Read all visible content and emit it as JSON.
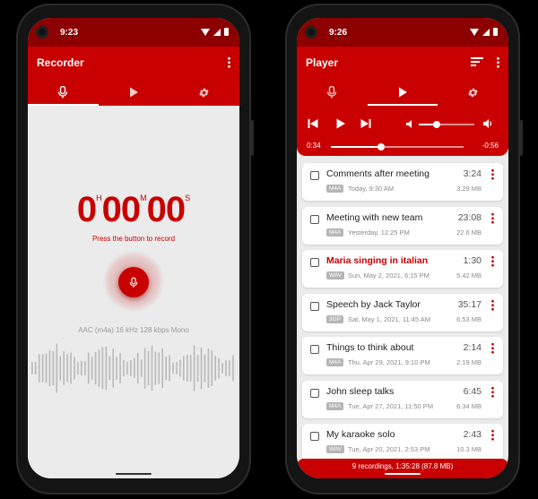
{
  "recorder": {
    "status_time": "9:23",
    "title": "Recorder",
    "tabs": [
      {
        "icon": "mic-icon",
        "active": true
      },
      {
        "icon": "play-icon",
        "active": false
      },
      {
        "icon": "gear-icon",
        "active": false
      }
    ],
    "timer": {
      "hours": "0",
      "hours_unit": "H",
      "minutes": "00",
      "minutes_unit": "M",
      "seconds": "00",
      "seconds_unit": "S"
    },
    "hint": "Press the button to record",
    "format_info": "AAC (m4a) 16 kHz 128 kbps Mono"
  },
  "player": {
    "status_time": "9:26",
    "title": "Player",
    "tabs": [
      {
        "icon": "mic-icon",
        "active": false
      },
      {
        "icon": "play-icon",
        "active": true
      },
      {
        "icon": "gear-icon",
        "active": false
      }
    ],
    "elapsed": "0:34",
    "remaining": "-0:56",
    "seek_fraction": 0.38,
    "volume_fraction": 0.33,
    "recordings": [
      {
        "name": "Comments after meeting",
        "format": "M4A",
        "date": "Today, 9:30 AM",
        "duration": "3:24",
        "size": "3.29 MB",
        "highlight": false
      },
      {
        "name": "Meeting with new team",
        "format": "M4A",
        "date": "Yesterday, 12:25 PM",
        "duration": "23:08",
        "size": "22.6 MB",
        "highlight": false
      },
      {
        "name": "Maria singing in italian",
        "format": "WAV",
        "date": "Sun, May 2, 2021, 6:15 PM",
        "duration": "1:30",
        "size": "5.42 MB",
        "highlight": true
      },
      {
        "name": "Speech by Jack Taylor",
        "format": "3GP",
        "date": "Sat, May 1, 2021, 11:45 AM",
        "duration": "35:17",
        "size": "6.53 MB",
        "highlight": false
      },
      {
        "name": "Things to think about",
        "format": "M4A",
        "date": "Thu, Apr 29, 2021, 9:10 PM",
        "duration": "2:14",
        "size": "2.19 MB",
        "highlight": false
      },
      {
        "name": "John sleep talks",
        "format": "M4A",
        "date": "Tue, Apr 27, 2021, 11:50 PM",
        "duration": "6:45",
        "size": "6.34 MB",
        "highlight": false
      },
      {
        "name": "My karaoke solo",
        "format": "WAV",
        "date": "Tue, Apr 20, 2021, 2:53 PM",
        "duration": "2:43",
        "size": "10.3 MB",
        "highlight": false
      }
    ],
    "summary": "9 recordings, 1:35:28 (87.8 MB)"
  },
  "colors": {
    "primary": "#c80000",
    "primary_dark": "#8c0000",
    "background": "#ebebeb"
  }
}
